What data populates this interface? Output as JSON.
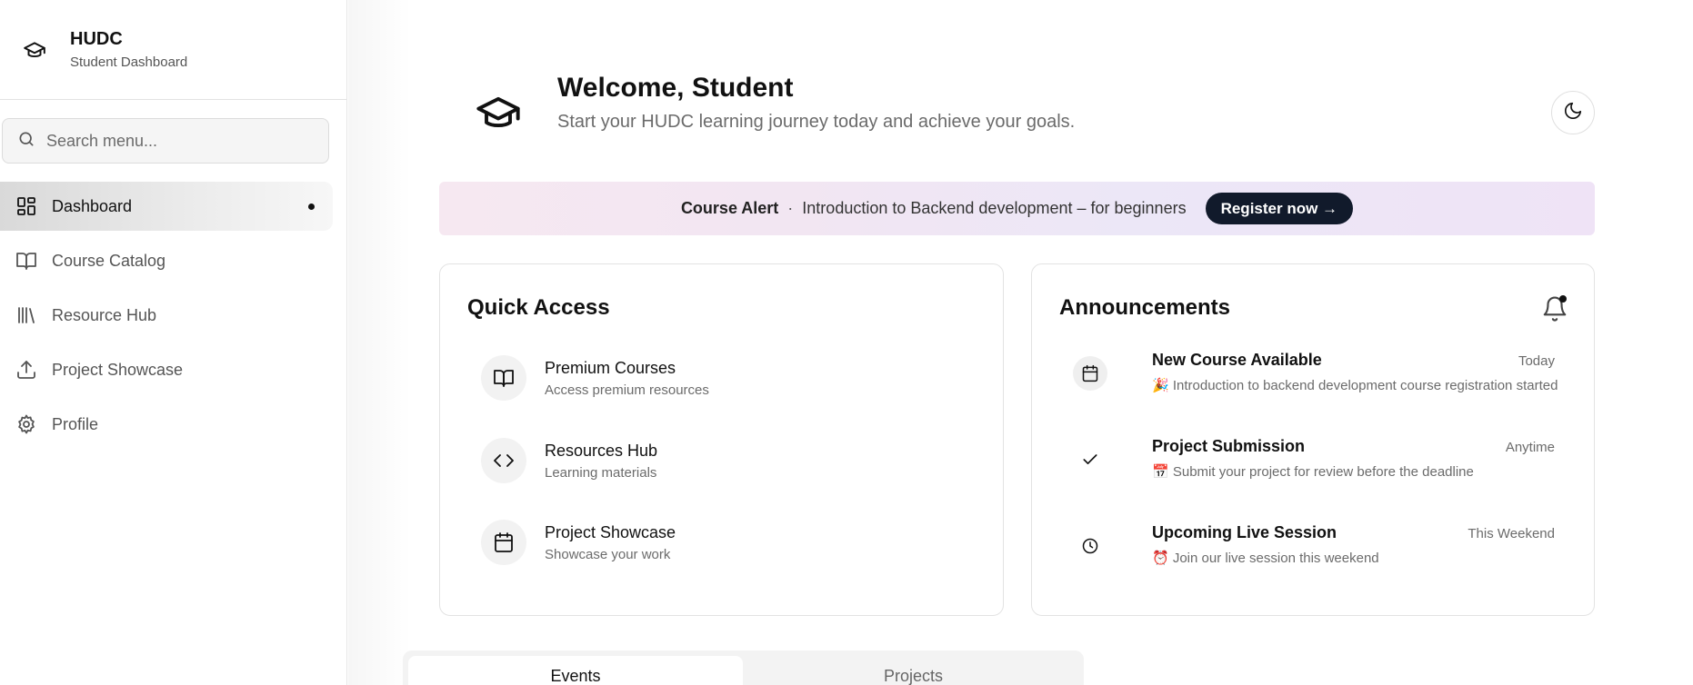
{
  "sidebar": {
    "brand_title": "HUDC",
    "brand_subtitle": "Student Dashboard",
    "search_placeholder": "Search menu...",
    "items": [
      {
        "label": "Dashboard",
        "icon": "dashboard-grid-icon",
        "active": true
      },
      {
        "label": "Course Catalog",
        "icon": "book-open-icon",
        "active": false
      },
      {
        "label": "Resource Hub",
        "icon": "library-icon",
        "active": false
      },
      {
        "label": "Project Showcase",
        "icon": "upload-icon",
        "active": false
      },
      {
        "label": "Profile",
        "icon": "gear-icon",
        "active": false
      }
    ]
  },
  "header": {
    "title": "Welcome, Student",
    "subtitle": "Start your HUDC learning journey today and achieve your goals.",
    "icon": "graduation-cap-icon",
    "theme_toggle_icon": "moon-icon"
  },
  "alert": {
    "label": "Course Alert",
    "separator": "·",
    "text": "Introduction to Backend development – for beginners",
    "button": "Register now →"
  },
  "quick_access": {
    "title": "Quick Access",
    "items": [
      {
        "title": "Premium Courses",
        "subtitle": "Access premium resources",
        "icon": "book-open-icon"
      },
      {
        "title": "Resources Hub",
        "subtitle": "Learning materials",
        "icon": "code-icon"
      },
      {
        "title": "Project Showcase",
        "subtitle": "Showcase your work",
        "icon": "calendar-icon"
      }
    ]
  },
  "announcements": {
    "title": "Announcements",
    "bell_icon": "bell-icon",
    "items": [
      {
        "title": "New Course Available",
        "time": "Today",
        "desc": "🎉 Introduction to backend development course registration started",
        "icon": "calendar-icon"
      },
      {
        "title": "Project Submission",
        "time": "Anytime",
        "desc": "📅 Submit your project for review before the deadline",
        "icon": "check-icon"
      },
      {
        "title": "Upcoming Live Session",
        "time": "This Weekend",
        "desc": "⏰ Join our live session this weekend",
        "icon": "clock-icon"
      }
    ]
  },
  "tabs": [
    {
      "label": "Events",
      "active": true
    },
    {
      "label": "Projects",
      "active": false
    }
  ]
}
